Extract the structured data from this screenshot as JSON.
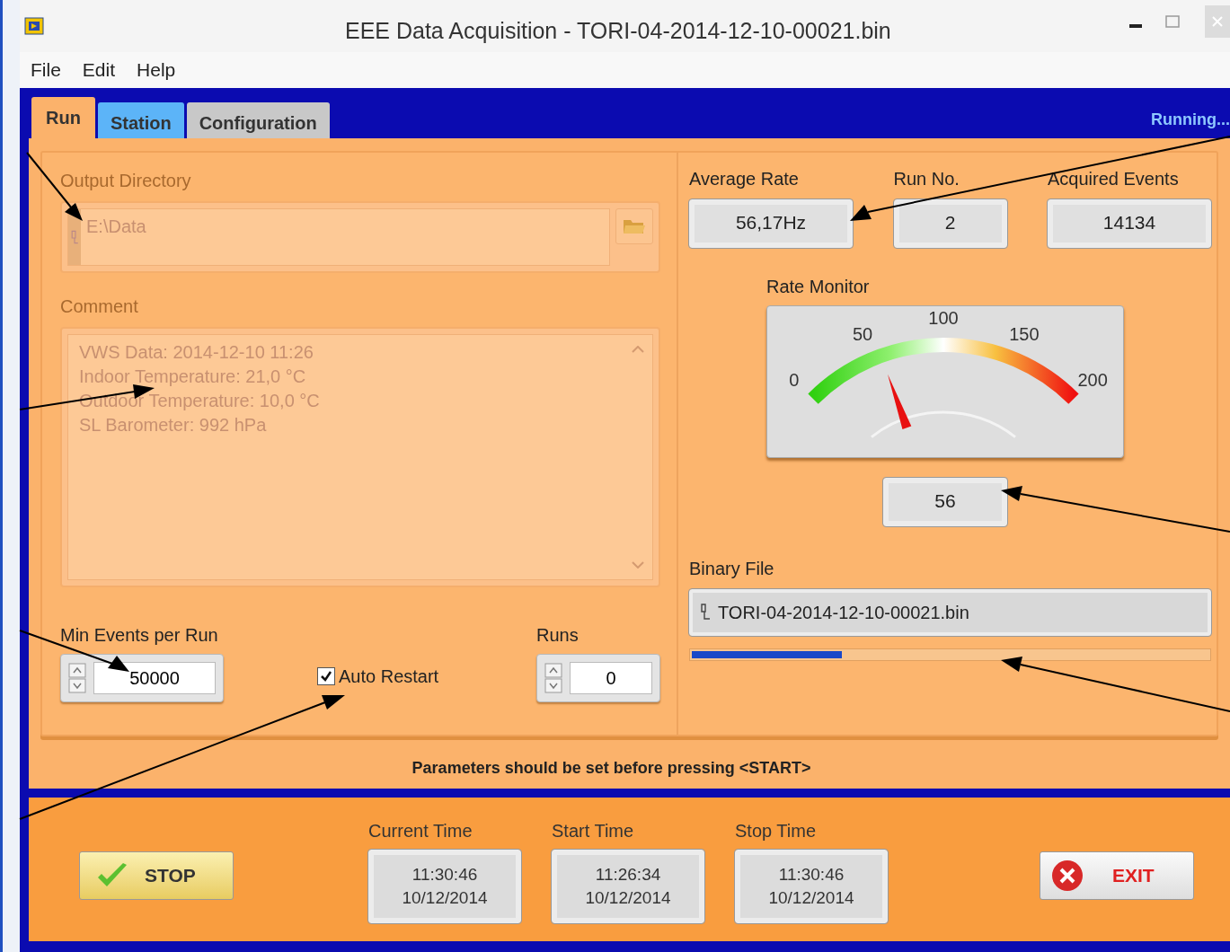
{
  "window": {
    "title": "EEE Data Acquisition - TORI-04-2014-12-10-00021.bin"
  },
  "menu": [
    "File",
    "Edit",
    "Help"
  ],
  "tabs": [
    {
      "label": "Run",
      "selected": true
    },
    {
      "label": "Station",
      "selected": false
    },
    {
      "label": "Configuration",
      "selected": false
    }
  ],
  "status": "Running...",
  "output_directory": {
    "label": "Output Directory",
    "value": "E:\\Data",
    "disabled": true
  },
  "comment": {
    "label": "Comment",
    "disabled": true,
    "lines": [
      "VWS Data: 2014-12-10 11:26",
      "Indoor Temperature: 21,0 °C",
      "Outdoor Temperature: 10,0 °C",
      "SL Barometer: 992 hPa"
    ]
  },
  "min_events": {
    "label": "Min Events per Run",
    "value": "50000"
  },
  "auto_restart": {
    "label": "Auto Restart",
    "checked": true
  },
  "runs": {
    "label": "Runs",
    "value": "0"
  },
  "indicators": [
    {
      "label": "Average Rate",
      "value": "56,17Hz"
    },
    {
      "label": "Run No.",
      "value": "2"
    },
    {
      "label": "Acquired Events",
      "value": "14134"
    }
  ],
  "rate_monitor": {
    "label": "Rate Monitor",
    "scale": [
      "0",
      "50",
      "100",
      "150",
      "200"
    ],
    "level": 0.28,
    "reading": "56"
  },
  "binary_file": {
    "label": "Binary File",
    "value": "TORI-04-2014-12-10-00021.bin",
    "level": 0.29
  },
  "message": "Parameters should be set before pressing <START>",
  "stop_button": "STOP",
  "times": [
    {
      "label": "Current Time",
      "time": "11:30:46",
      "date": "10/12/2014"
    },
    {
      "label": "Start Time",
      "time": "11:26:34",
      "date": "10/12/2014"
    },
    {
      "label": "Stop Time",
      "time": "11:30:46",
      "date": "10/12/2014"
    }
  ],
  "exit_button": "EXIT"
}
